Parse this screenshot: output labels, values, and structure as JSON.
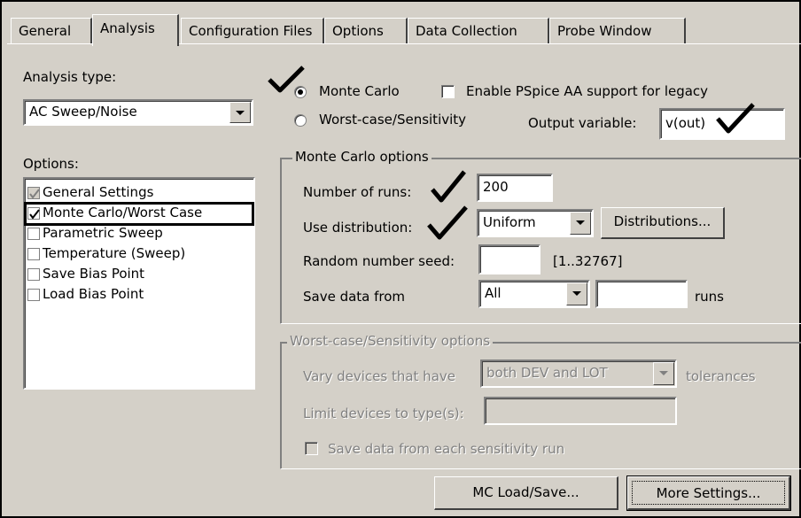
{
  "tabs": [
    "General",
    "Analysis",
    "Configuration Files",
    "Options",
    "Data Collection",
    "Probe Window"
  ],
  "active_tab": "Analysis",
  "analysis_type": {
    "label": "Analysis type:",
    "value": "AC Sweep/Noise"
  },
  "options": {
    "label": "Options:",
    "items": [
      {
        "label": "General Settings",
        "checked": true,
        "disabled": true
      },
      {
        "label": "Monte Carlo/Worst Case",
        "checked": true,
        "selected": true
      },
      {
        "label": "Parametric Sweep",
        "checked": false
      },
      {
        "label": "Temperature (Sweep)",
        "checked": false
      },
      {
        "label": "Save Bias Point",
        "checked": false
      },
      {
        "label": "Load Bias Point",
        "checked": false
      }
    ]
  },
  "mode": {
    "monte_carlo": "Monte Carlo",
    "worst_case": "Worst-case/Sensitivity",
    "selected": "Monte Carlo",
    "legacy_checkbox": "Enable PSpice AA support for legacy",
    "output_variable_label": "Output variable:",
    "output_variable_value": "v(out)"
  },
  "monte_carlo_options": {
    "title": "Monte Carlo options",
    "runs_label": "Number of runs:",
    "runs_value": "200",
    "distribution_label": "Use distribution:",
    "distribution_value": "Uniform",
    "distributions_button": "Distributions...",
    "seed_label": "Random number seed:",
    "seed_value": "",
    "seed_range": "[1..32767]",
    "save_label": "Save data from",
    "save_value": "All",
    "save_runs_value": "",
    "runs_suffix": "runs"
  },
  "worst_case_options": {
    "title": "Worst-case/Sensitivity options",
    "vary_label": "Vary devices that have",
    "vary_value": "both DEV and LOT",
    "tolerances": "tolerances",
    "limit_label": "Limit devices to type(s):",
    "limit_value": "",
    "save_each": "Save data from each sensitivity run"
  },
  "buttons": {
    "mc_load_save": "MC Load/Save...",
    "more_settings": "More Settings..."
  },
  "colors": {
    "face": "#d4d0c8",
    "annotation_check": "#000000"
  }
}
